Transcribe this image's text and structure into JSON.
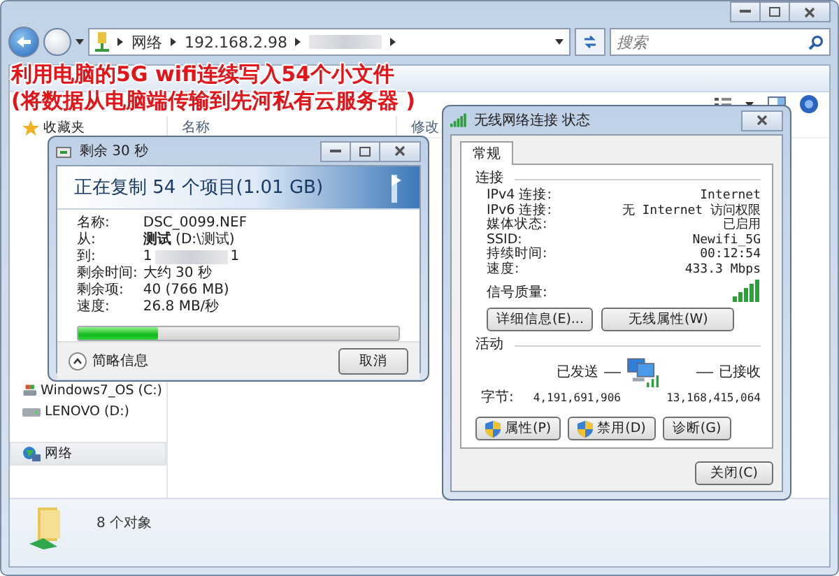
{
  "explorer": {
    "breadcrumb": [
      "网络",
      "192.168.2.98"
    ],
    "search": {
      "placeholder": "搜索"
    },
    "columns": [
      "名称",
      "修改"
    ],
    "sidebar": [
      {
        "label": "收藏夹",
        "kind": "favorites",
        "selected": false
      },
      {
        "label": "Windows7_OS (C:)",
        "kind": "system-drive",
        "selected": false
      },
      {
        "label": "LENOVO (D:)",
        "kind": "drive",
        "selected": false
      },
      {
        "label": "网络",
        "kind": "network",
        "selected": true
      }
    ],
    "status": "8 个对象"
  },
  "annotation": [
    "利用电脑的5G wifi连续写入54个小文件",
    "(将数据从电脑端传输到先河私有云服务器 )"
  ],
  "copy_dialog": {
    "title": "剩余 30 秒",
    "heading": "正在复制 54 个项目(1.01 GB)",
    "details": [
      {
        "label": "名称:",
        "value": "DSC_0099.NEF"
      },
      {
        "label": "从:",
        "value": "**测试** (D:\\测试)"
      },
      {
        "label": "到:",
        "value": "1",
        "redacted": true,
        "value_end": "1"
      },
      {
        "label": "剩余时间:",
        "value": "大约 30 秒"
      },
      {
        "label": "剩余项:",
        "value": "40 (766 MB)"
      },
      {
        "label": "速度:",
        "value": "26.8 MB/秒"
      }
    ],
    "progress": {
      "level": 0.25
    },
    "toggle": "简略信息",
    "cancel": "取消"
  },
  "network_dialog": {
    "title": "无线网络连接 状态",
    "tabs": [
      {
        "label": "常规",
        "selected": true
      }
    ],
    "connection": {
      "heading": "连接",
      "rows": [
        {
          "label": "IPv4 连接:",
          "value": "Internet"
        },
        {
          "label": "IPv6 连接:",
          "value": "无 Internet 访问权限"
        },
        {
          "label": "媒体状态:",
          "value": "已启用"
        },
        {
          "label": "SSID:",
          "value": "Newifi_5G"
        },
        {
          "label": "持续时间:",
          "value": "00:12:54"
        },
        {
          "label": "速度:",
          "value": "433.3 Mbps"
        }
      ],
      "signal_label": "信号质量:",
      "buttons": [
        "详细信息(E)...",
        "无线属性(W)"
      ]
    },
    "activity": {
      "heading": "活动",
      "sent_label": "已发送",
      "received_label": "已接收",
      "bytes_label": "字节:",
      "sent": "4,191,691,906",
      "received": "13,168,415,064"
    },
    "buttons": [
      {
        "label": "属性(P)",
        "shield": true
      },
      {
        "label": "禁用(D)",
        "shield": true
      },
      {
        "label": "诊断(G)",
        "shield": false
      }
    ],
    "close": "关闭(C)"
  }
}
